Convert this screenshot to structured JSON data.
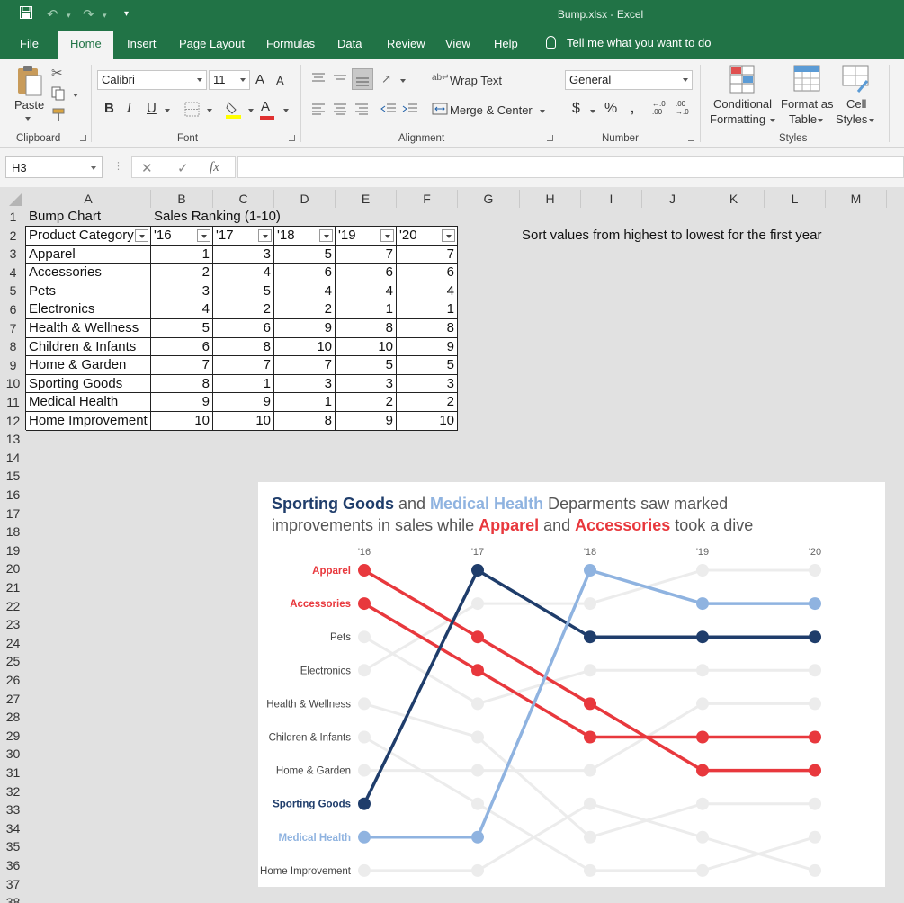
{
  "window": {
    "title": "Bump.xlsx  -  Excel"
  },
  "tabs": [
    {
      "label": "File"
    },
    {
      "label": "Home"
    },
    {
      "label": "Insert"
    },
    {
      "label": "Page Layout"
    },
    {
      "label": "Formulas"
    },
    {
      "label": "Data"
    },
    {
      "label": "Review"
    },
    {
      "label": "View"
    },
    {
      "label": "Help"
    }
  ],
  "tell_me": "Tell me what you want to do",
  "ribbon": {
    "clipboard": {
      "paste": "Paste",
      "label": "Clipboard"
    },
    "font": {
      "name": "Calibri",
      "size": "11",
      "label": "Font",
      "bold": "B",
      "italic": "I",
      "underline": "U",
      "grow": "A",
      "shrink": "A",
      "color_letter": "A"
    },
    "alignment": {
      "wrap": "Wrap Text",
      "merge": "Merge & Center",
      "label": "Alignment"
    },
    "number": {
      "format": "General",
      "label": "Number",
      "currency": "$",
      "percent": "%",
      "comma": "͘",
      "inc": "←.0 .00",
      "dec": ".00 →.0"
    },
    "styles": {
      "conditional": [
        "Conditional",
        "Formatting"
      ],
      "table": [
        "Format as",
        "Table"
      ],
      "cell": [
        "Cell",
        "Styles"
      ],
      "label": "Styles"
    },
    "colors": {
      "highlight": "#ffff00",
      "font_color": "#e03030"
    }
  },
  "formula_bar": {
    "name_box": "H3",
    "fx": "fx",
    "formula": ""
  },
  "columns": [
    "A",
    "B",
    "C",
    "D",
    "E",
    "F",
    "G",
    "H",
    "I",
    "J",
    "K",
    "L",
    "M"
  ],
  "rows": [
    "1",
    "2",
    "3",
    "4",
    "5",
    "6",
    "7",
    "8",
    "9",
    "10",
    "11",
    "12",
    "13",
    "14",
    "15",
    "16",
    "17",
    "18",
    "19",
    "20",
    "21",
    "22",
    "23",
    "24",
    "25",
    "26",
    "27",
    "28",
    "29",
    "30",
    "31",
    "32",
    "33",
    "34",
    "35",
    "36",
    "37",
    "38"
  ],
  "sheet": {
    "a1": "Bump Chart",
    "b1": "Sales Ranking (1-10)",
    "note": "Sort values from highest to lowest for the first year",
    "header": [
      "Product Category",
      "'16",
      "'17",
      "'18",
      "'19",
      "'20"
    ],
    "table": [
      [
        "Apparel",
        "1",
        "3",
        "5",
        "7",
        "7"
      ],
      [
        "Accessories",
        "2",
        "4",
        "6",
        "6",
        "6"
      ],
      [
        "Pets",
        "3",
        "5",
        "4",
        "4",
        "4"
      ],
      [
        "Electronics",
        "4",
        "2",
        "2",
        "1",
        "1"
      ],
      [
        "Health & Wellness",
        "5",
        "6",
        "9",
        "8",
        "8"
      ],
      [
        "Children & Infants",
        "6",
        "8",
        "10",
        "10",
        "9"
      ],
      [
        "Home & Garden",
        "7",
        "7",
        "7",
        "5",
        "5"
      ],
      [
        "Sporting Goods",
        "8",
        "1",
        "3",
        "3",
        "3"
      ],
      [
        "Medical Health",
        "9",
        "9",
        "1",
        "2",
        "2"
      ],
      [
        "Home Improvement",
        "10",
        "10",
        "8",
        "9",
        "10"
      ]
    ]
  },
  "chart_data": {
    "type": "line",
    "title_parts": [
      {
        "text": "Sporting Goods",
        "color": "#1f3d6b",
        "bold": true
      },
      {
        "text": " and ",
        "color": "#555555",
        "bold": false
      },
      {
        "text": "Medical Health",
        "color": "#8fb3e0",
        "bold": true
      },
      {
        "text": " Deparments saw marked",
        "color": "#555555",
        "bold": false
      },
      {
        "text": "improvements in sales while ",
        "color": "#555555",
        "bold": false,
        "newline": true
      },
      {
        "text": "Apparel",
        "color": "#e8383d",
        "bold": true
      },
      {
        "text": " and ",
        "color": "#555555",
        "bold": false
      },
      {
        "text": "Accessories",
        "color": "#e8383d",
        "bold": true
      },
      {
        "text": " took a dive",
        "color": "#555555",
        "bold": false
      }
    ],
    "categories": [
      "'16",
      "'17",
      "'18",
      "'19",
      "'20"
    ],
    "y_reversed": true,
    "ylim": [
      1,
      10
    ],
    "series": [
      {
        "name": "Apparel",
        "values": [
          1,
          3,
          5,
          7,
          7
        ],
        "color": "#e8383d",
        "highlight": true
      },
      {
        "name": "Accessories",
        "values": [
          2,
          4,
          6,
          6,
          6
        ],
        "color": "#e8383d",
        "highlight": true
      },
      {
        "name": "Pets",
        "values": [
          3,
          5,
          4,
          4,
          4
        ],
        "color": "#ececec",
        "highlight": false
      },
      {
        "name": "Electronics",
        "values": [
          4,
          2,
          2,
          1,
          1
        ],
        "color": "#ececec",
        "highlight": false
      },
      {
        "name": "Health & Wellness",
        "values": [
          5,
          6,
          9,
          8,
          8
        ],
        "color": "#ececec",
        "highlight": false
      },
      {
        "name": "Children & Infants",
        "values": [
          6,
          8,
          10,
          10,
          9
        ],
        "color": "#ececec",
        "highlight": false
      },
      {
        "name": "Home & Garden",
        "values": [
          7,
          7,
          7,
          5,
          5
        ],
        "color": "#ececec",
        "highlight": false
      },
      {
        "name": "Sporting Goods",
        "values": [
          8,
          1,
          3,
          3,
          3
        ],
        "color": "#1f3d6b",
        "highlight": true
      },
      {
        "name": "Medical Health",
        "values": [
          9,
          9,
          1,
          2,
          2
        ],
        "color": "#8fb3e0",
        "highlight": true
      },
      {
        "name": "Home Improvement",
        "values": [
          10,
          10,
          8,
          9,
          10
        ],
        "color": "#ececec",
        "highlight": false
      }
    ]
  }
}
